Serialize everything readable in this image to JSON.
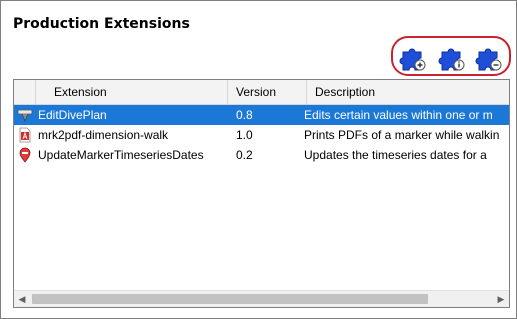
{
  "panel": {
    "title": "Production Extensions"
  },
  "toolbar": {
    "buttons": [
      {
        "name": "add-extension-button",
        "icon": "puzzle-add-icon"
      },
      {
        "name": "info-extension-button",
        "icon": "puzzle-info-icon"
      },
      {
        "name": "remove-extension-button",
        "icon": "puzzle-remove-icon"
      }
    ],
    "icon_color": "#1f4fd8",
    "highlight_color": "#c8242f"
  },
  "table": {
    "columns": [
      "Extension",
      "Version",
      "Description"
    ],
    "rows": [
      {
        "icon": "dive-plan-icon",
        "extension": "EditDivePlan",
        "version": "0.8",
        "description": "Edits certain values within one or m",
        "selected": true
      },
      {
        "icon": "pdf-icon",
        "extension": "mrk2pdf-dimension-walk",
        "version": "1.0",
        "description": "Prints PDFs of a marker while walkin",
        "selected": false
      },
      {
        "icon": "marker-timeseries-icon",
        "extension": "UpdateMarkerTimeseriesDates",
        "version": "0.2",
        "description": "Updates the timeseries dates for a",
        "selected": false
      }
    ],
    "selection_color": "#1c78d6"
  }
}
